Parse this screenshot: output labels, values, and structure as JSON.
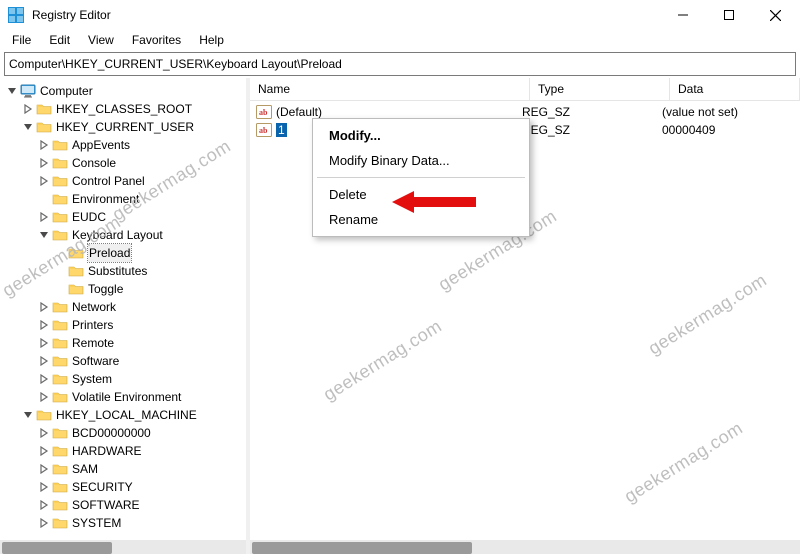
{
  "window": {
    "title": "Registry Editor"
  },
  "menubar": {
    "items": [
      "File",
      "Edit",
      "View",
      "Favorites",
      "Help"
    ]
  },
  "address": {
    "path": "Computer\\HKEY_CURRENT_USER\\Keyboard Layout\\Preload"
  },
  "winbuttons": {
    "min": "Minimize",
    "max": "Maximize",
    "close": "Close"
  },
  "tree": {
    "items": [
      {
        "indent": 0,
        "label": "Computer",
        "icon": "monitor",
        "twisty": "open"
      },
      {
        "indent": 1,
        "label": "HKEY_CLASSES_ROOT",
        "icon": "folder",
        "twisty": "closed"
      },
      {
        "indent": 1,
        "label": "HKEY_CURRENT_USER",
        "icon": "folder",
        "twisty": "open"
      },
      {
        "indent": 2,
        "label": "AppEvents",
        "icon": "folder",
        "twisty": "closed"
      },
      {
        "indent": 2,
        "label": "Console",
        "icon": "folder",
        "twisty": "closed"
      },
      {
        "indent": 2,
        "label": "Control Panel",
        "icon": "folder",
        "twisty": "closed"
      },
      {
        "indent": 2,
        "label": "Environment",
        "icon": "folder",
        "twisty": "none"
      },
      {
        "indent": 2,
        "label": "EUDC",
        "icon": "folder",
        "twisty": "closed"
      },
      {
        "indent": 2,
        "label": "Keyboard Layout",
        "icon": "folder",
        "twisty": "open"
      },
      {
        "indent": 3,
        "label": "Preload",
        "icon": "folder",
        "twisty": "none",
        "selected": true
      },
      {
        "indent": 3,
        "label": "Substitutes",
        "icon": "folder",
        "twisty": "none"
      },
      {
        "indent": 3,
        "label": "Toggle",
        "icon": "folder",
        "twisty": "none"
      },
      {
        "indent": 2,
        "label": "Network",
        "icon": "folder",
        "twisty": "closed"
      },
      {
        "indent": 2,
        "label": "Printers",
        "icon": "folder",
        "twisty": "closed"
      },
      {
        "indent": 2,
        "label": "Remote",
        "icon": "folder",
        "twisty": "closed"
      },
      {
        "indent": 2,
        "label": "Software",
        "icon": "folder",
        "twisty": "closed"
      },
      {
        "indent": 2,
        "label": "System",
        "icon": "folder",
        "twisty": "closed"
      },
      {
        "indent": 2,
        "label": "Volatile Environment",
        "icon": "folder",
        "twisty": "closed"
      },
      {
        "indent": 1,
        "label": "HKEY_LOCAL_MACHINE",
        "icon": "folder",
        "twisty": "open"
      },
      {
        "indent": 2,
        "label": "BCD00000000",
        "icon": "folder",
        "twisty": "closed"
      },
      {
        "indent": 2,
        "label": "HARDWARE",
        "icon": "folder",
        "twisty": "closed"
      },
      {
        "indent": 2,
        "label": "SAM",
        "icon": "folder",
        "twisty": "closed"
      },
      {
        "indent": 2,
        "label": "SECURITY",
        "icon": "folder",
        "twisty": "closed"
      },
      {
        "indent": 2,
        "label": "SOFTWARE",
        "icon": "folder",
        "twisty": "closed"
      },
      {
        "indent": 2,
        "label": "SYSTEM",
        "icon": "folder",
        "twisty": "closed"
      }
    ]
  },
  "list": {
    "columns": {
      "name": "Name",
      "type": "Type",
      "data": "Data"
    },
    "rows": [
      {
        "name": "(Default)",
        "type": "REG_SZ",
        "data": "(value not set)",
        "selected": false
      },
      {
        "name": "1",
        "type": "REG_SZ",
        "data": "00000409",
        "selected": true
      }
    ]
  },
  "contextmenu": {
    "items": {
      "modify": "Modify...",
      "modify_binary": "Modify Binary Data...",
      "delete": "Delete",
      "rename": "Rename"
    }
  },
  "watermark": "geekermag.com"
}
